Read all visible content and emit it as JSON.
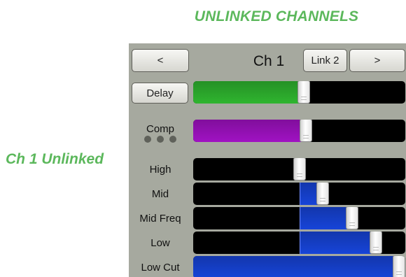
{
  "heading": "UNLINKED CHANNELS",
  "side_label": "Ch 1 Unlinked",
  "nav": {
    "prev_label": "<",
    "channel_title": "Ch 1",
    "link_label": "Link 2",
    "next_label": ">"
  },
  "delay": {
    "label": "Delay",
    "value_fraction": 0.52,
    "fill_color": "#2fb52f"
  },
  "comp": {
    "label": "Comp",
    "value_fraction": 0.53,
    "fill_color": "#a012c3"
  },
  "eq": [
    {
      "key": "high",
      "label": "High",
      "value_fraction": 0.5
    },
    {
      "key": "mid",
      "label": "Mid",
      "value_fraction": 0.61
    },
    {
      "key": "mid-freq",
      "label": "Mid Freq",
      "value_fraction": 0.75
    },
    {
      "key": "low",
      "label": "Low",
      "value_fraction": 0.86
    },
    {
      "key": "low-cut",
      "label": "Low Cut",
      "value_fraction": 1.0
    }
  ],
  "colors": {
    "accent": "#5cb85c",
    "panel": "#a6a99f",
    "eq_fill": "#1744d8"
  }
}
